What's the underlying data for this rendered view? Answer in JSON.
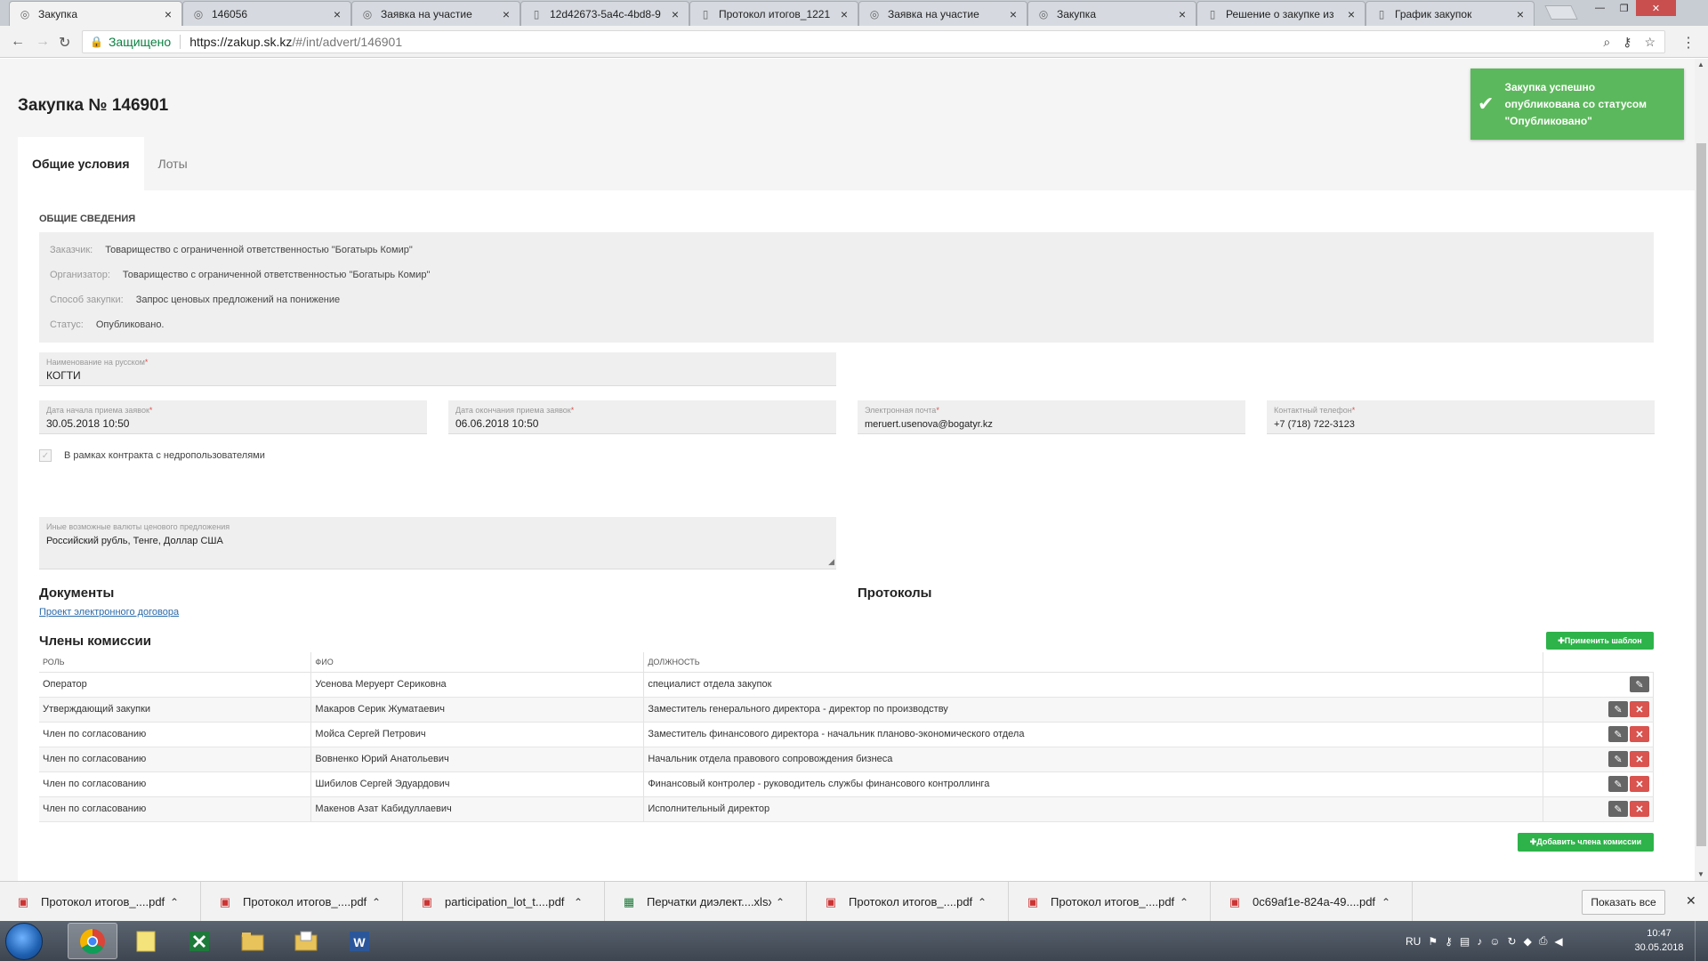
{
  "browser": {
    "tabs": [
      {
        "title": "Закупка",
        "active": true
      },
      {
        "title": "146056"
      },
      {
        "title": "Заявка на участие"
      },
      {
        "title": "12d42673-5a4c-4bd8-9"
      },
      {
        "title": "Протокол итогов_1221"
      },
      {
        "title": "Заявка на участие"
      },
      {
        "title": "Закупка"
      },
      {
        "title": "Решение о закупке из"
      },
      {
        "title": "График закупок"
      }
    ],
    "secure_label": "Защищено",
    "url_host": "https://zakup.sk.kz",
    "url_path": "/#/int/advert/146901"
  },
  "page": {
    "title": "Закупка № 146901",
    "tabs": [
      "Общие условия",
      "Лоты"
    ],
    "section_general": "ОБЩИЕ СВЕДЕНИЯ",
    "info": {
      "customer_label": "Заказчик:",
      "customer": "Товарищество с ограниченной ответственностью \"Богатырь Комир\"",
      "organizer_label": "Организатор:",
      "organizer": "Товарищество с ограниченной ответственностью \"Богатырь Комир\"",
      "method_label": "Способ закупки:",
      "method": "Запрос ценовых предложений на понижение",
      "status_label": "Статус:",
      "status": "Опубликовано."
    },
    "fields": {
      "name_ru_label": "Наименование на русском",
      "name_ru": "КОГТИ",
      "start_label": "Дата начала приема заявок",
      "start": "30.05.2018 10:50",
      "end_label": "Дата окончания приема заявок",
      "end": "06.06.2018 10:50",
      "email_label": "Электронная почта",
      "email": "meruert.usenova@bogatyr.kz",
      "phone_label": "Контактный телефон",
      "phone": "+7 (718) 722-3123",
      "checkbox_label": "В рамках контракта с недропользователями",
      "currencies_label": "Иные возможные валюты ценового предложения",
      "currencies": "Российский  рубль, Тенге, Доллар США"
    },
    "documents_title": "Документы",
    "documents_link": "Проект электронного договора",
    "protocols_title": "Протоколы",
    "commission_title": "Члены комиссии",
    "apply_template_btn": "✚Применить шаблон",
    "add_member_btn": "✚Добавить члена комиссии",
    "table_headers": [
      "РОЛЬ",
      "ФИО",
      "ДОЛЖНОСТЬ"
    ],
    "members": [
      {
        "role": "Оператор",
        "name": "Усенова Меруерт Сериковна",
        "position": "специалист отдела закупок",
        "deletable": false
      },
      {
        "role": "Утверждающий закупки",
        "name": "Макаров Серик Жуматаевич",
        "position": "Заместитель генерального директора - директор по производству",
        "deletable": true
      },
      {
        "role": "Член по согласованию",
        "name": "Мойса Сергей Петрович",
        "position": "Заместитель финансового директора - начальник планово-экономического отдела",
        "deletable": true
      },
      {
        "role": "Член по согласованию",
        "name": "Вовненко Юрий Анатольевич",
        "position": "Начальник отдела правового сопровождения бизнеса",
        "deletable": true
      },
      {
        "role": "Член по согласованию",
        "name": "Шибилов Сергей Эдуардович",
        "position": "Финансовый контролер - руководитель службы финансового контроллинга",
        "deletable": true
      },
      {
        "role": "Член по согласованию",
        "name": "Макенов Азат Кабидуллаевич",
        "position": "Исполнительный директор",
        "deletable": true
      }
    ]
  },
  "toast": {
    "message": "Закупка успешно опубликована со статусом \"Опубликовано\""
  },
  "downloads": {
    "items": [
      {
        "name": "Протокол итогов_....pdf",
        "type": "pdf"
      },
      {
        "name": "Протокол итогов_....pdf",
        "type": "pdf"
      },
      {
        "name": "participation_lot_t....pdf",
        "type": "pdf"
      },
      {
        "name": "Перчатки диэлект....xlsx",
        "type": "xlsx"
      },
      {
        "name": "Протокол итогов_....pdf",
        "type": "pdf"
      },
      {
        "name": "Протокол итогов_....pdf",
        "type": "pdf"
      },
      {
        "name": "0c69af1e-824a-49....pdf",
        "type": "pdf"
      }
    ],
    "show_all": "Показать все"
  },
  "taskbar": {
    "lang": "RU",
    "time": "10:47",
    "date": "30.05.2018"
  },
  "icons": {
    "check": "check-icon",
    "edit": "pencil-icon",
    "delete": "close-icon"
  },
  "colors": {
    "accent_green": "#2db34a",
    "toast_green": "#5cb85c",
    "delete_red": "#d9534f"
  }
}
